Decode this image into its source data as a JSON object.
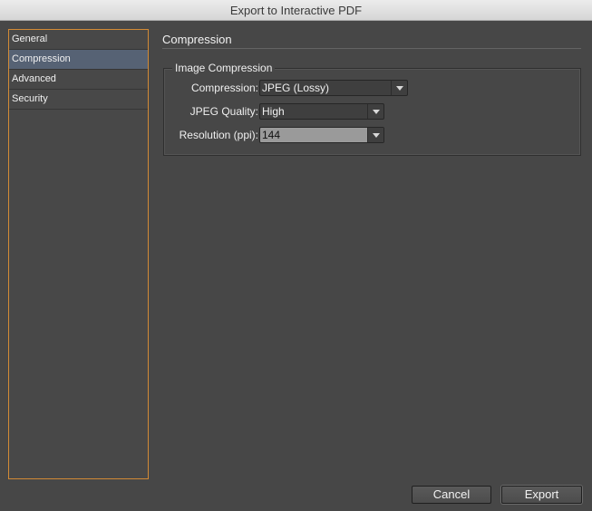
{
  "window": {
    "title": "Export to Interactive PDF"
  },
  "sidebar": {
    "items": [
      {
        "label": "General"
      },
      {
        "label": "Compression"
      },
      {
        "label": "Advanced"
      },
      {
        "label": "Security"
      }
    ],
    "selected": "Compression"
  },
  "panel": {
    "title": "Compression",
    "image_compression": {
      "legend": "Image Compression",
      "compression": {
        "label": "Compression:",
        "value": "JPEG (Lossy)"
      },
      "jpeg_quality": {
        "label": "JPEG Quality:",
        "value": "High"
      },
      "resolution": {
        "label": "Resolution (ppi):",
        "value": "144"
      }
    }
  },
  "buttons": {
    "cancel": "Cancel",
    "export": "Export"
  },
  "colors": {
    "selection": "#566274",
    "sidebar_border": "#d28a35"
  }
}
